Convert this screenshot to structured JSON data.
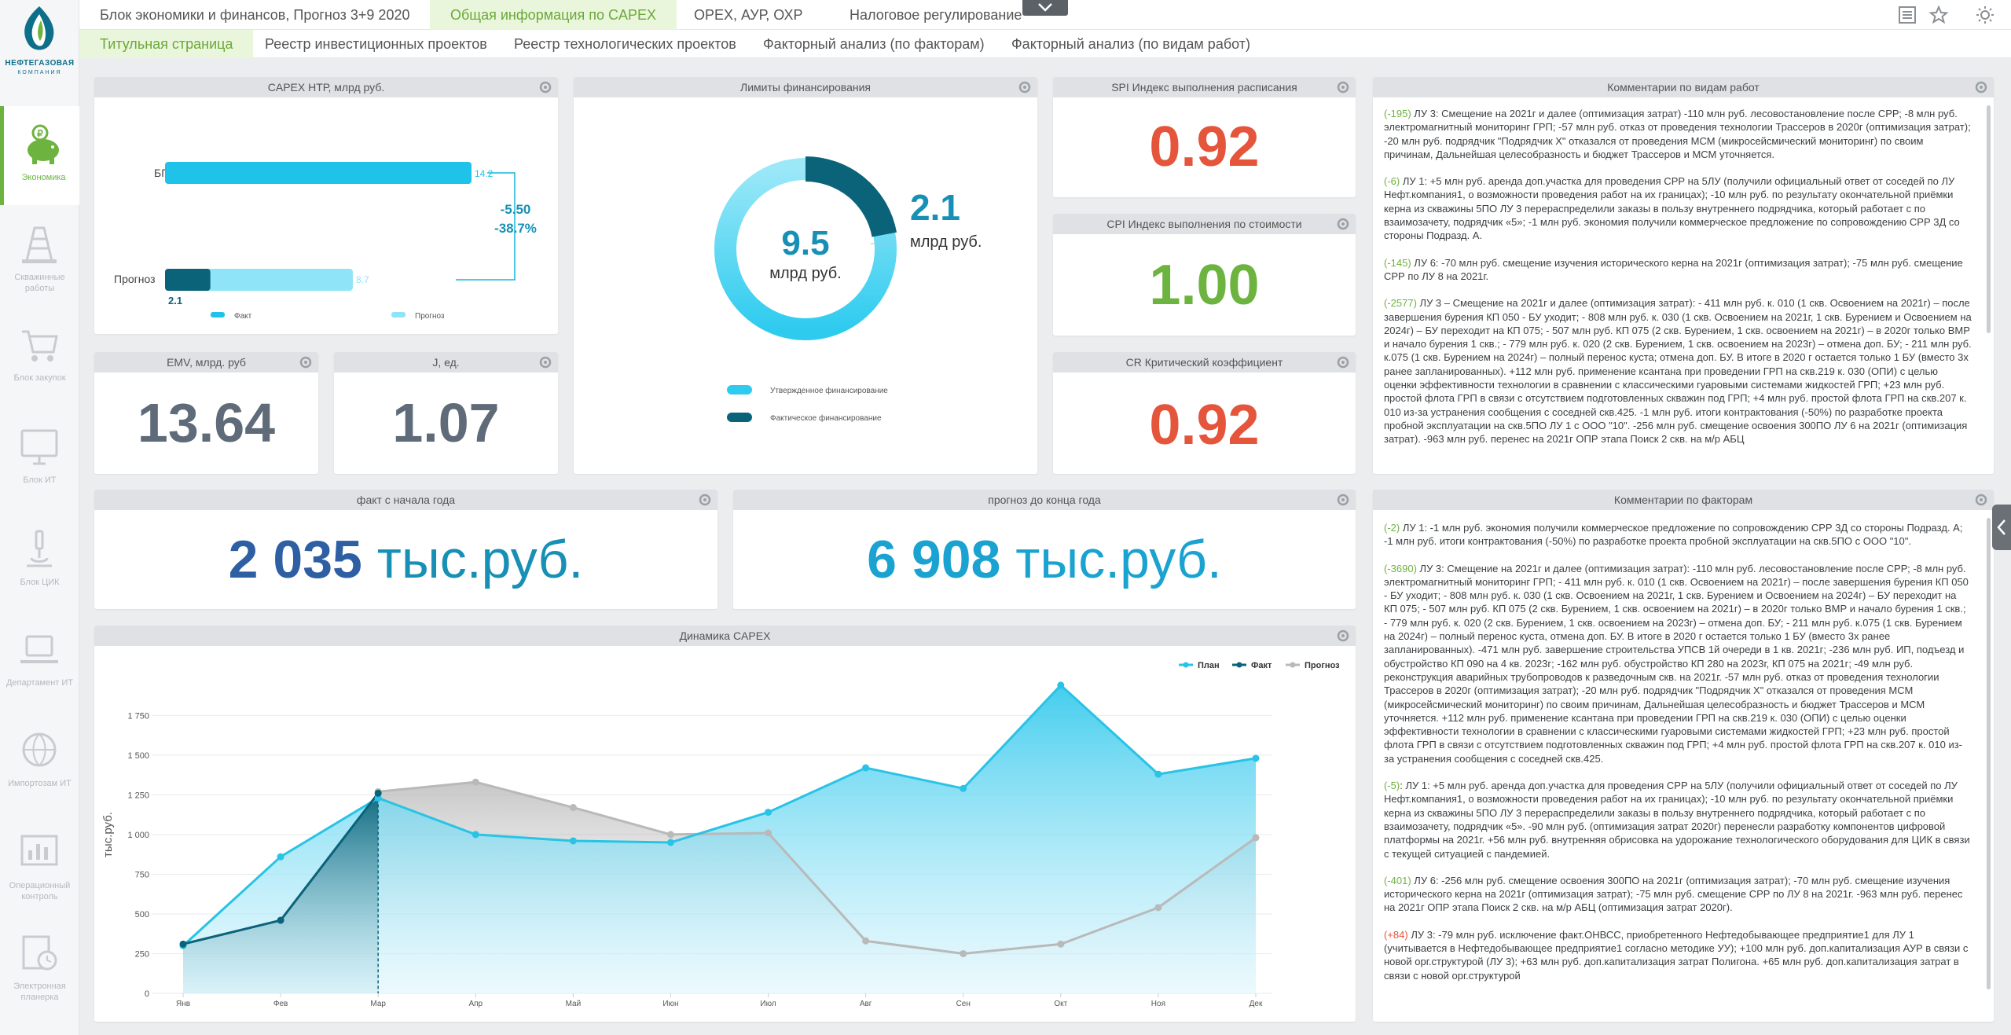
{
  "brand": {
    "line1": "НЕФТЕГАЗОВАЯ",
    "line2": "КОМПАНИЯ",
    "green": "#6db33f",
    "blue": "#0e6f8a"
  },
  "sidebar": {
    "items": [
      {
        "label": "Экономика",
        "icon": "piggy-bank-icon"
      },
      {
        "label": "Скважинные работы",
        "icon": "drilling-rig-icon"
      },
      {
        "label": "Блок закупок",
        "icon": "shopping-cart-icon"
      },
      {
        "label": "Блок ИТ",
        "icon": "monitor-icon"
      },
      {
        "label": "Блок ЦИК",
        "icon": "microscope-icon"
      },
      {
        "label": "Департамент ИТ",
        "icon": "laptop-icon"
      },
      {
        "label": "Импортозам ИТ",
        "icon": "globe-icon"
      },
      {
        "label": "Операционный контроль",
        "icon": "bar-chart-icon"
      },
      {
        "label": "Электронная планерка",
        "icon": "schedule-icon"
      }
    ]
  },
  "header": {
    "tabs": [
      "Блок экономики и финансов, Прогноз 3+9 2020",
      "Общая информация по CAPEX",
      "OPEX, АУР, ОХР",
      "Налоговое регулирование"
    ],
    "subtabs": [
      "Титульная страница",
      "Реестр инвестиционных проектов",
      "Реестр технологических проектов",
      "Факторный анализ (по факторам)",
      "Факторный анализ (по видам работ)"
    ]
  },
  "capex_ntr": {
    "title": "CAPEX НТР, млрд руб.",
    "bp_label": "БП",
    "bp_value": 14.2,
    "bp_value_text": "14.2",
    "forecast_label": "Прогноз",
    "forecast_value": 8.7,
    "forecast_value_text": "8.7",
    "fact_value": 2.1,
    "fact_value_text": "2.1",
    "diff": "-5.50",
    "diff_pct": "-38.7%",
    "legend_fact": "Факт",
    "legend_forecast": "Прогноз"
  },
  "limits": {
    "title": "Лимиты финансирования",
    "total": "9.5",
    "total_unit": "млрд руб.",
    "actual": "2.1",
    "actual_unit": "млрд руб.",
    "actual_share": 0.221,
    "legend_approved": "Утвержденное финансирование",
    "legend_actual": "Фактическое финансирование"
  },
  "kpi": {
    "spi": {
      "title": "SPI Индекс выполнения расписания",
      "value": "0.92",
      "color": "#e4553b"
    },
    "cpi": {
      "title": "CPI Индекс выполнения по стоимости",
      "value": "1.00",
      "color": "#6db33f"
    },
    "cr": {
      "title": "CR Критический коэффициент",
      "value": "0.92",
      "color": "#e4553b"
    },
    "emv": {
      "title": "EMV, млрд. руб",
      "value": "13.64"
    },
    "j": {
      "title": "J, ед.",
      "value": "1.07"
    }
  },
  "ytd": {
    "title": "факт с начала года",
    "number": "2 035",
    "unit": "тыс.руб."
  },
  "forecast_eoy": {
    "title": "прогноз до конца года",
    "number": "6 908",
    "unit": "тыс.руб."
  },
  "comments_work": {
    "title": "Комментарии по видам работ",
    "items": [
      {
        "code": "(-195)",
        "text": " ЛУ 3: Смещение на 2021г и далее (оптимизация затрат) -110 млн руб. лесовостановление после СРР; -8 млн руб. электромагнитный мониторинг ГРП; -57 млн руб. отказ от проведения технологии Трассеров в 2020г (оптимизация затрат); -20 млн руб. подрядчик \"Подрядчик Х\" отказался от проведения МСМ (микросейсмический мониторинг) по своим причинам, Дальнейшая целесобразность и бюджет Трассеров и МСМ уточняется."
      },
      {
        "code": "(-6)",
        "text": " ЛУ 1: +5 млн руб. аренда доп.участка для проведения СРР на 5ЛУ (получили официальный ответ от соседей по ЛУ Нефт.компания1, о возможности проведения работ на их границах); -10 млн руб. по результату окончательной приёмки керна из скважины 5ПО ЛУ 3 перераспределили заказы в пользу внутреннего подрядчика, который работает с по взаимозачету, подрядчик «5»; -1 млн руб. экономия получили коммерческое предложение по сопровождению СРР 3Д со стороны Подразд. А."
      },
      {
        "code": "(-145)",
        "text": " ЛУ 6: -70 млн руб. смещение изучения исторического керна на 2021г (оптимизация затрат); -75 млн руб. смещение СРР по ЛУ 8 на 2021г."
      },
      {
        "code": "(-2577)",
        "text": " ЛУ 3 – Смещение на 2021г и далее (оптимизация затрат): - 411 млн руб. к. 010 (1 скв. Освоением на 2021г) – после завершения бурения КП 050 - БУ уходит; - 808 млн руб. к. 030 (1 скв. Освоением на 2021г, 1 скв. Бурением и Освоением на 2024г) – БУ переходит на КП 075; - 507 млн руб. КП 075 (2 скв. Бурением, 1 скв. освоением на 2021г) – в 2020г только ВМР и начало бурения 1 скв.; - 779 млн руб. к. 020 (2 скв. Бурением, 1 скв. освоением на 2023г) – отмена доп. БУ; - 211 млн руб. к.075 (1 скв. Бурением на 2024г) – полный перенос куста; отмена доп. БУ. В итоге в 2020 г остается только 1 БУ (вместо 3х ранее запланированных). +112 млн руб. применение ксантана при проведении ГРП на скв.219 к. 030 (ОПИ) с целью оценки эффективности технологии в сравнении с классическими гуаровыми системами жидкостей ГРП; +23 млн руб. простой флота ГРП в связи с отсутствием подготовленных скважин под ГРП; +4 млн руб. простой флота ГРП на скв.207 к. 010 из-за устранения сообщения с соседней скв.425. -1 млн руб. итоги контрактования (-50%) по разработке проекта пробной эксплуатации на скв.5ПО ЛУ 1 с ООО \"10\". -256 млн руб. смещение освоения 300ПО ЛУ 6 на 2021г (оптимизация затрат). -963 млн руб. перенес на 2021г ОПР этапа Поиск 2 скв. на м/р АБЦ"
      }
    ]
  },
  "comments_factors": {
    "title": "Комментарии по факторам",
    "items": [
      {
        "code": "(-2)",
        "text": " ЛУ 1: -1 млн руб. экономия получили коммерческое предложение по сопровождению СРР 3Д со стороны Подразд. А; -1 млн руб. итоги контрактования (-50%) по разработке проекта пробной эксплуатации на скв.5ПО с ООО \"10\"."
      },
      {
        "code": "(-3690)",
        "text": " ЛУ 3: Смещение на 2021г и далее (оптимизация затрат): -110 млн руб. лесовостановление после СРР; -8 млн руб. электромагнитный мониторинг ГРП; - 411 млн руб. к. 010 (1 скв. Освоением на 2021г) – после завершения бурения КП 050 - БУ уходит; - 808 млн руб. к. 030 (1 скв. Освоением на 2021г, 1 скв. Бурением и Освоением на 2024г) – БУ переходит на КП 075; - 507 млн руб. КП 075 (2 скв. Бурением, 1 скв. освоением на 2021г) – в 2020г только ВМР и начало бурения 1 скв.; - 779 млн руб. к. 020 (2 скв. Бурением, 1 скв. освоением на 2023г) – отмена доп. БУ; - 211 млн руб. к.075 (1 скв. Бурением на 2024г) – полный перенос куста, отмена доп. БУ. В итоге в 2020 г остается только 1 БУ (вместо 3х ранее запланированных). -471 млн руб. завершение строительства УПСВ 1й очереди в 1 кв. 2021г; -236 млн руб. ИП, подъезд и обустройство КП 090 на 4 кв. 2023г; -162 млн руб. обустройство КП 280 на 2023г, КП 075 на 2021г; -49 млн руб. реконструкция аварийных трубопроводов к разведочным скв. на 2021г. -57 млн руб. отказ от проведения технологии Трассеров в 2020г (оптимизация затрат); -20 млн руб. подрядчик \"Подрядчик Х\" отказался от проведения МСМ (микросейсмический мониторинг) по своим причинам, Дальнейшая целесобразность и бюджет Трассеров и МСМ уточняется. +112 млн руб. применение ксантана при проведении ГРП на скв.219 к. 030 (ОПИ) с целью оценки эффективности технологии в сравнении с классическими гуаровыми системами жидкостей ГРП; +23 млн руб. простой флота ГРП в связи с отсутствием подготовленных скважин под ГРП; +4 млн руб. простой флота ГРП на скв.207 к. 010 из-за устранения сообщения с соседней скв.425."
      },
      {
        "code": "(-5)",
        "text": ": ЛУ 1: +5 млн руб. аренда доп.участка для проведения СРР на 5ЛУ (получили официальный ответ от соседей по ЛУ Нефт.компания1, о возможности проведения работ на их границах); -10 млн руб. по результату окончательной приёмки керна из скважины 5ПО ЛУ 3 перераспределили заказы в пользу внутреннего подрядчика, который работает с по взаимозачету, подрядчик «5». -90 млн руб. (оптимизация затрат 2020г) перенесли разработку компонентов цифровой платформы на 2021г. +56 млн руб. внутренняя обрисовка на удорожание технологического оборудования для ЦИК в связи с текущей ситуацией с пандемией."
      },
      {
        "code": "(-401)",
        "text": " ЛУ 6: -256 млн руб. смещение освоения 300ПО на 2021г (оптимизация затрат); -70 млн руб. смещение изучения исторического керна на 2021г (оптимизация затрат); -75 млн руб. смещение СРР по ЛУ 8 на 2021г. -963 млн руб. перенес на 2021г ОПР этапа Поиск 2 скв. на м/р АБЦ (оптимизация затрат 2020г)."
      },
      {
        "code": "(+84)",
        "text": " ЛУ 3: -79 млн руб. исключение факт.ОНВСС, приобретенного Нефтедобывающее предприятие1 для ЛУ 1 (учитывается в Нефтедобывающее предприятие1 согласно методике УУ); +100 млн руб. доп.капитализация АУР в связи с новой орг.структурой (ЛУ 3); +63 млн руб. доп.капитализация затрат Полигона. +65 млн руб. доп.капитализация затрат в связи с новой орг.структурой"
      }
    ]
  },
  "chart_data": {
    "type": "area",
    "title": "Динамика CAPEX",
    "ylabel": "тыс.руб.",
    "categories": [
      "Янв",
      "Фев",
      "Мар",
      "Апр",
      "Май",
      "Июн",
      "Июл",
      "Авг",
      "Сен",
      "Окт",
      "Ноя",
      "Дек"
    ],
    "yticks": [
      "0",
      "250",
      "500",
      "750",
      "1 000",
      "1 250",
      "1 500",
      "1 750"
    ],
    "ylim": [
      0,
      1900
    ],
    "series": [
      {
        "name": "План",
        "color": "#29c3e6",
        "values": [
          300,
          860,
          1230,
          1000,
          960,
          950,
          1140,
          1420,
          1290,
          1940,
          1380,
          1480
        ]
      },
      {
        "name": "Факт",
        "color": "#0b637a",
        "values": [
          310,
          460,
          1260,
          null,
          null,
          null,
          null,
          null,
          null,
          null,
          null,
          null
        ]
      },
      {
        "name": "Прогноз",
        "color": "#b9b9b9",
        "values": [
          null,
          null,
          1270,
          1330,
          1170,
          1000,
          1010,
          330,
          250,
          310,
          540,
          980
        ]
      }
    ],
    "legend_position": "top-right"
  }
}
